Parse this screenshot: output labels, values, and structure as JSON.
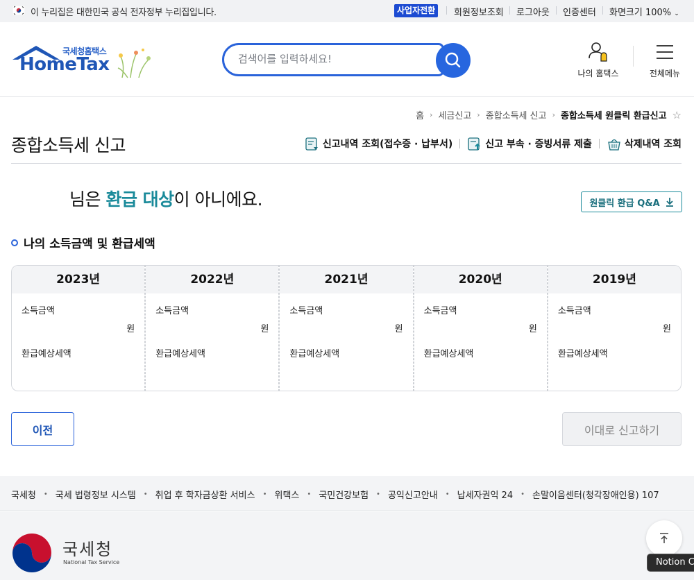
{
  "govbar": {
    "notice": "이 누리집은 대한민국 공식 전자정부 누리집입니다.",
    "business_switch": "사업자전환",
    "member_info": "회원정보조회",
    "logout": "로그아웃",
    "cert_center": "인증센터",
    "screen_size": "화면크기 100%"
  },
  "header": {
    "logo_sub": "국세청홈택스",
    "logo_main": "HomeTax",
    "search_placeholder": "검색어를 입력하세요!",
    "my_hometax": "나의 홈택스",
    "all_menu": "전체메뉴"
  },
  "breadcrumb": [
    "홈",
    "세금신고",
    "종합소득세 신고",
    "종합소득세 원클릭 환급신고"
  ],
  "page": {
    "title": "종합소득세 신고",
    "quicklinks": [
      "신고내역 조회(접수증 · 납부서)",
      "신고 부속 · 증빙서류 제출",
      "삭제내역 조회"
    ],
    "message_prefix": "님은 ",
    "message_highlight": "환급 대상",
    "message_suffix": "이 아니에요.",
    "qa_button": "원클릭 환급 Q&A",
    "section_title": "나의 소득금액 및 환급세액"
  },
  "cards": [
    {
      "year": "2023년",
      "income_label": "소득금액",
      "unit": "원",
      "refund_label": "환급예상세액"
    },
    {
      "year": "2022년",
      "income_label": "소득금액",
      "unit": "원",
      "refund_label": "환급예상세액"
    },
    {
      "year": "2021년",
      "income_label": "소득금액",
      "unit": "원",
      "refund_label": "환급예상세액"
    },
    {
      "year": "2020년",
      "income_label": "소득금액",
      "unit": "원",
      "refund_label": "환급예상세액"
    },
    {
      "year": "2019년",
      "income_label": "소득금액",
      "unit": "원",
      "refund_label": "환급예상세액"
    }
  ],
  "actions": {
    "prev": "이전",
    "submit": "이대로 신고하기"
  },
  "footer": {
    "links": [
      "국세청",
      "국세 법령정보 시스템",
      "취업 후 학자금상환 서비스",
      "위택스",
      "국민건강보험",
      "공익신고안내",
      "납세자권익 24",
      "손말이음센터(청각장애인용) 107"
    ],
    "org_name": "국세청",
    "org_en": "National Tax Service",
    "tooltip": "Notion C"
  },
  "colors": {
    "brand_blue": "#2766df",
    "teal_highlight": "#1a8a9a"
  }
}
